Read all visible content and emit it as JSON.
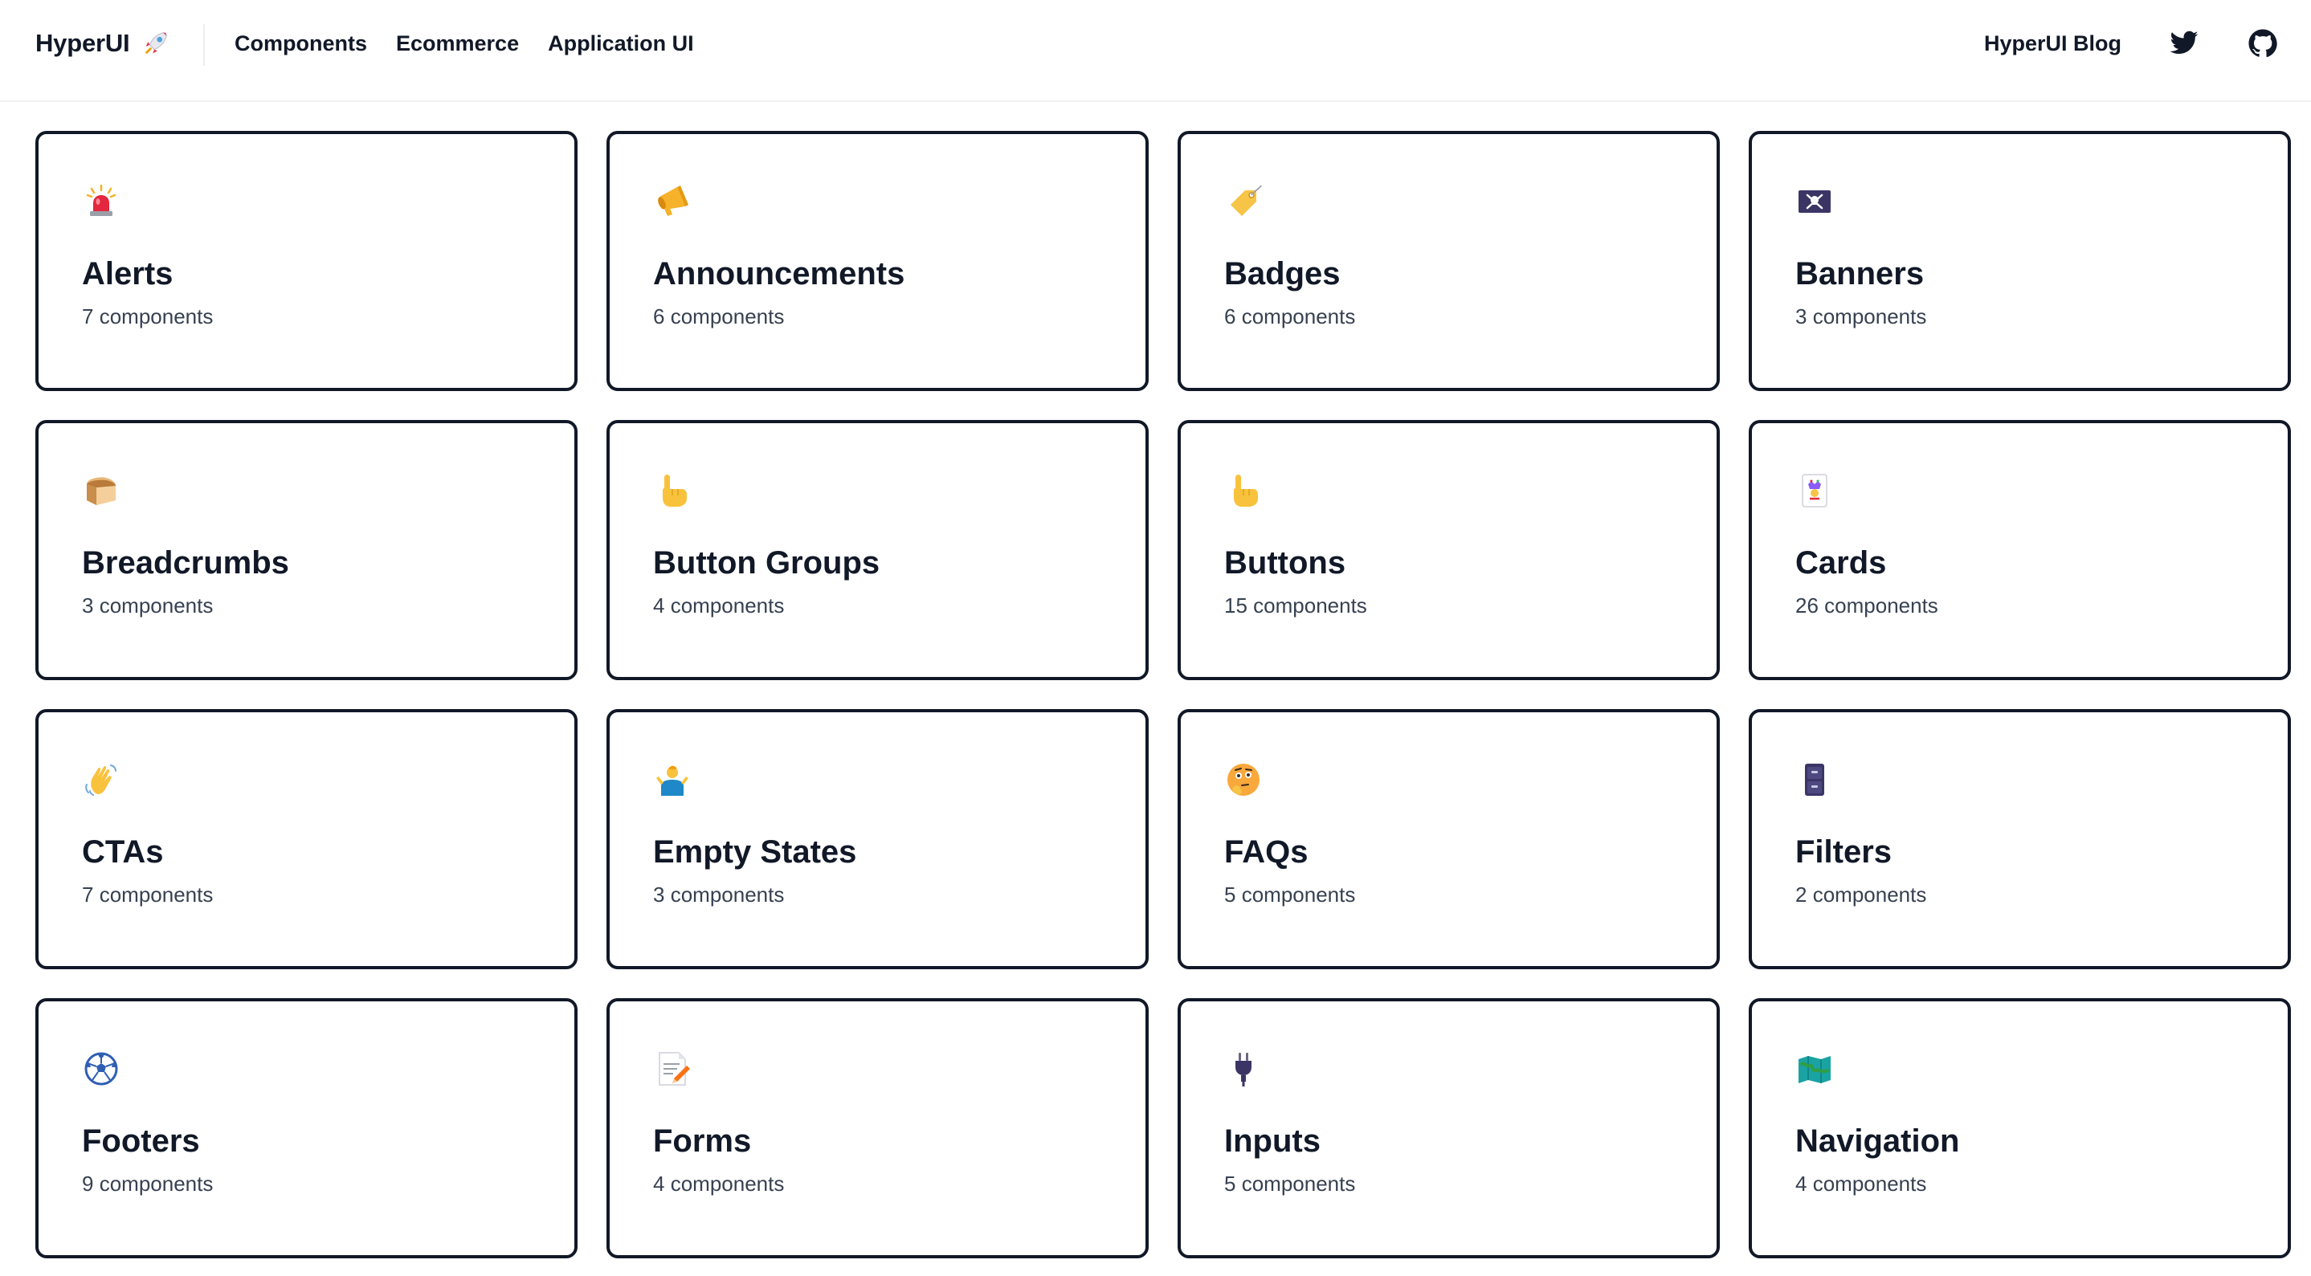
{
  "header": {
    "brand": "HyperUI",
    "nav": [
      {
        "label": "Components"
      },
      {
        "label": "Ecommerce"
      },
      {
        "label": "Application UI"
      }
    ],
    "blog_label": "HyperUI Blog",
    "social": [
      "twitter-icon",
      "github-icon"
    ]
  },
  "count_word": "components",
  "cards": [
    {
      "title": "Alerts",
      "count": "7",
      "icon": "police-light-icon"
    },
    {
      "title": "Announcements",
      "count": "6",
      "icon": "megaphone-icon"
    },
    {
      "title": "Badges",
      "count": "6",
      "icon": "tag-icon"
    },
    {
      "title": "Banners",
      "count": "3",
      "icon": "pirate-flag-icon"
    },
    {
      "title": "Breadcrumbs",
      "count": "3",
      "icon": "bread-icon"
    },
    {
      "title": "Button Groups",
      "count": "4",
      "icon": "pointing-hand-icon"
    },
    {
      "title": "Buttons",
      "count": "15",
      "icon": "pointing-hand-icon"
    },
    {
      "title": "Cards",
      "count": "26",
      "icon": "joker-card-icon"
    },
    {
      "title": "CTAs",
      "count": "7",
      "icon": "waving-hand-icon"
    },
    {
      "title": "Empty States",
      "count": "3",
      "icon": "shrug-icon"
    },
    {
      "title": "FAQs",
      "count": "5",
      "icon": "thinking-face-icon"
    },
    {
      "title": "Filters",
      "count": "2",
      "icon": "file-cabinet-icon"
    },
    {
      "title": "Footers",
      "count": "9",
      "icon": "soccer-ball-icon"
    },
    {
      "title": "Forms",
      "count": "4",
      "icon": "memo-icon"
    },
    {
      "title": "Inputs",
      "count": "5",
      "icon": "plug-icon"
    },
    {
      "title": "Navigation",
      "count": "4",
      "icon": "map-icon"
    }
  ]
}
